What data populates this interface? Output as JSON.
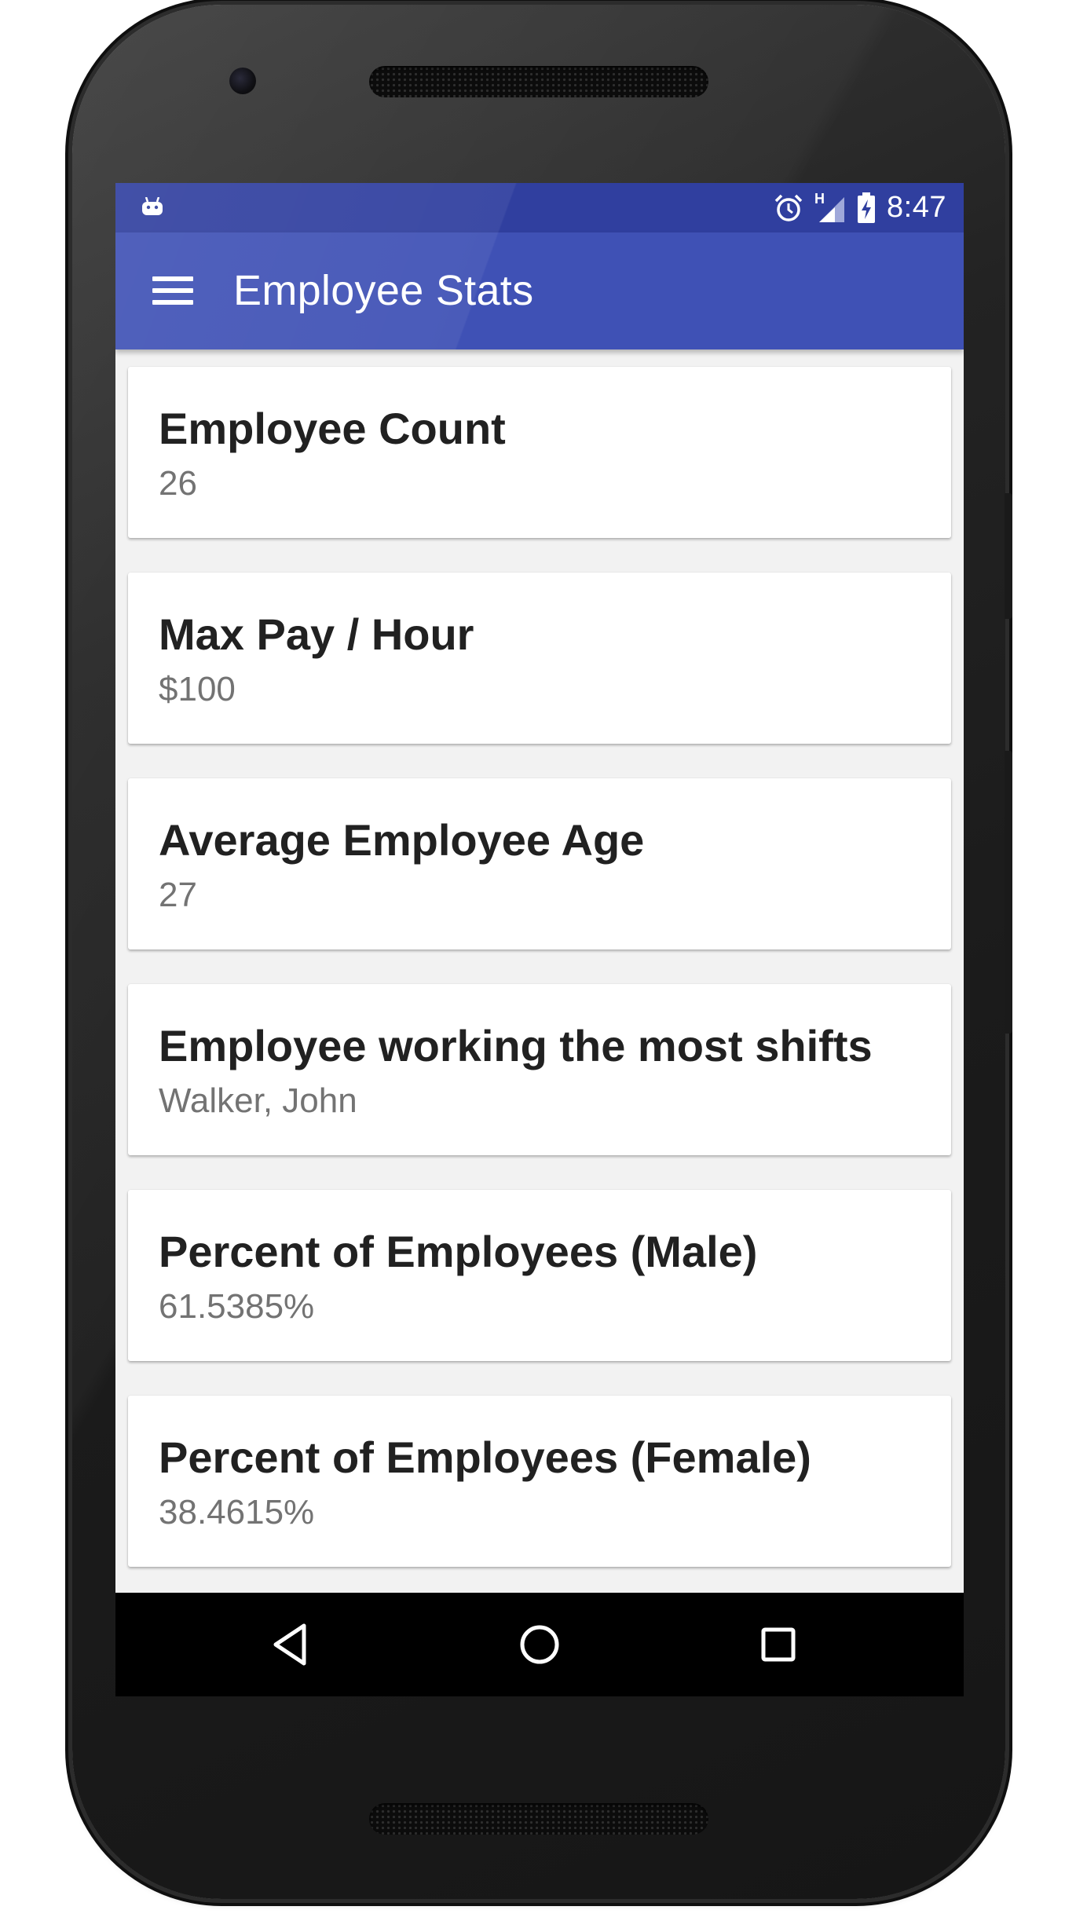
{
  "status_bar": {
    "time": "8:47",
    "network_label": "H",
    "icons": [
      "android-debug-icon",
      "alarm-icon",
      "signal-icon",
      "battery-charging-icon"
    ]
  },
  "app_bar": {
    "title": "Employee Stats",
    "menu_icon": "hamburger-menu-icon"
  },
  "stats": [
    {
      "title": "Employee Count",
      "value": "26"
    },
    {
      "title": "Max Pay / Hour",
      "value": "$100"
    },
    {
      "title": "Average Employee Age",
      "value": "27"
    },
    {
      "title": "Employee working the most shifts",
      "value": "Walker, John"
    },
    {
      "title": "Percent of Employees (Male)",
      "value": "61.5385%"
    },
    {
      "title": "Percent of Employees (Female)",
      "value": "38.4615%"
    }
  ],
  "nav_bar": {
    "icons": [
      "back-icon",
      "home-icon",
      "recents-icon"
    ]
  },
  "colors": {
    "status_bar": "#303f9f",
    "app_bar": "#3f51b5",
    "card_title": "#212121",
    "card_value": "#737373"
  }
}
